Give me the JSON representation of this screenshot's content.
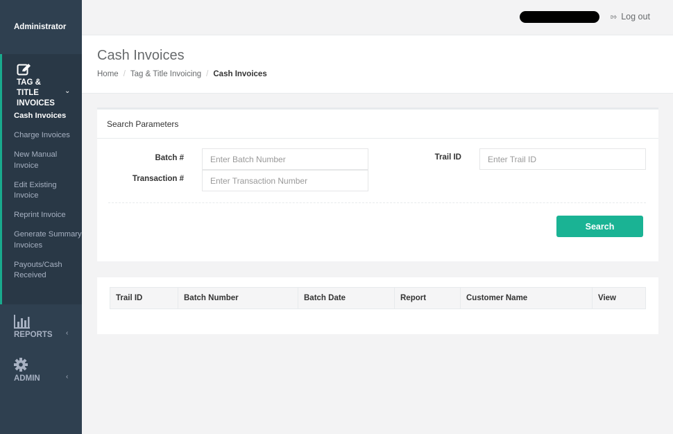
{
  "sidebar": {
    "user": "Administrator",
    "section": {
      "icon": "edit-icon",
      "label": "TAG & TITLE INVOICES",
      "items": [
        {
          "label": "Cash Invoices",
          "active": true
        },
        {
          "label": "Charge Invoices"
        },
        {
          "label": "New Manual Invoice"
        },
        {
          "label": "Edit Existing Invoice"
        },
        {
          "label": "Reprint Invoice"
        },
        {
          "label": "Generate Summary Invoices"
        },
        {
          "label": "Payouts/Cash Received"
        }
      ]
    },
    "reports": {
      "label": "REPORTS",
      "icon": "bar-chart-icon"
    },
    "admin": {
      "label": "ADMIN",
      "icon": "gear-icon"
    }
  },
  "topbar": {
    "logout": "Log out"
  },
  "page": {
    "title": "Cash Invoices",
    "breadcrumb": [
      "Home",
      "Tag & Title Invoicing",
      "Cash Invoices"
    ]
  },
  "search": {
    "title": "Search Parameters",
    "batch_label": "Batch #",
    "batch_placeholder": "Enter Batch Number",
    "transaction_label": "Transaction #",
    "transaction_placeholder": "Enter Transaction Number",
    "trail_label": "Trail ID",
    "trail_placeholder": "Enter Trail ID",
    "button": "Search"
  },
  "results": {
    "columns": [
      "Trail ID",
      "Batch Number",
      "Batch Date",
      "Report",
      "Customer Name",
      "View"
    ]
  },
  "colors": {
    "accent": "#1ab394",
    "sidebar": "#2f4050"
  }
}
